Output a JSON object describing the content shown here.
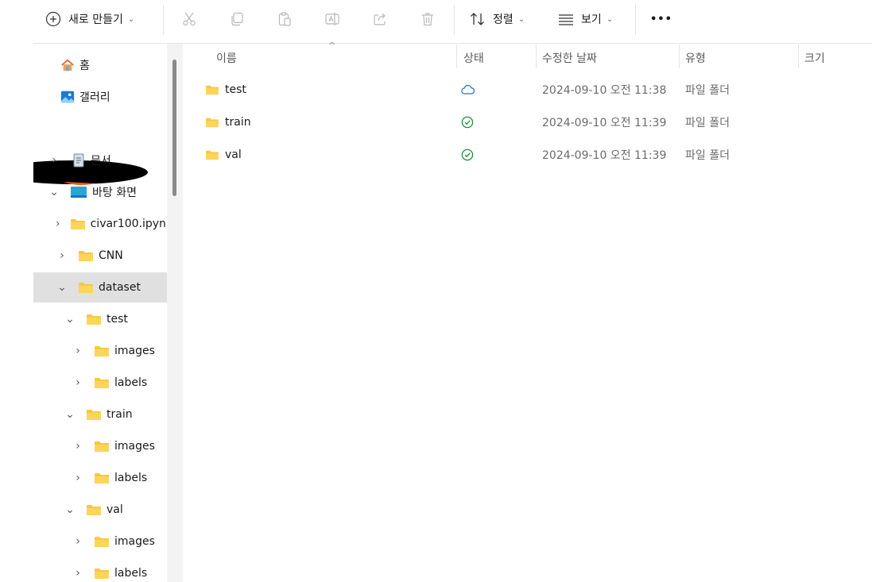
{
  "toolbar": {
    "new_label": "새로 만들기",
    "sort_label": "정렬",
    "view_label": "보기",
    "more_label": "•••"
  },
  "sidebar": {
    "items": [
      {
        "label": "홈",
        "icon": "home-icon"
      },
      {
        "label": "갤러리",
        "icon": "gallery-icon"
      },
      {
        "label": "문서",
        "icon": "document-icon"
      },
      {
        "label": "바탕 화면",
        "icon": "desktop-icon"
      },
      {
        "label": "civar100.ipynb",
        "icon": "folder-icon"
      },
      {
        "label": "CNN",
        "icon": "folder-icon"
      },
      {
        "label": "dataset",
        "icon": "folder-icon"
      },
      {
        "label": "test",
        "icon": "folder-icon"
      },
      {
        "label": "images",
        "icon": "folder-icon"
      },
      {
        "label": "labels",
        "icon": "folder-icon"
      },
      {
        "label": "train",
        "icon": "folder-icon"
      },
      {
        "label": "images",
        "icon": "folder-icon"
      },
      {
        "label": "labels",
        "icon": "folder-icon"
      },
      {
        "label": "val",
        "icon": "folder-icon"
      },
      {
        "label": "images",
        "icon": "folder-icon"
      },
      {
        "label": "labels",
        "icon": "folder-icon"
      }
    ]
  },
  "columns": {
    "name": "이름",
    "status": "상태",
    "modified": "수정한 날짜",
    "type": "유형",
    "size": "크기"
  },
  "files": [
    {
      "name": "test",
      "status": "cloud",
      "modified": "2024-09-10 오전 11:38",
      "type": "파일 폴더"
    },
    {
      "name": "train",
      "status": "synced",
      "modified": "2024-09-10 오전 11:39",
      "type": "파일 폴더"
    },
    {
      "name": "val",
      "status": "synced",
      "modified": "2024-09-10 오전 11:39",
      "type": "파일 폴더"
    }
  ],
  "colors": {
    "folder": "#f8c840",
    "folder_dark": "#e3a92a",
    "cloud": "#1a73c8",
    "synced": "#1f8a3a",
    "selected_bg": "#e0e0e0"
  }
}
